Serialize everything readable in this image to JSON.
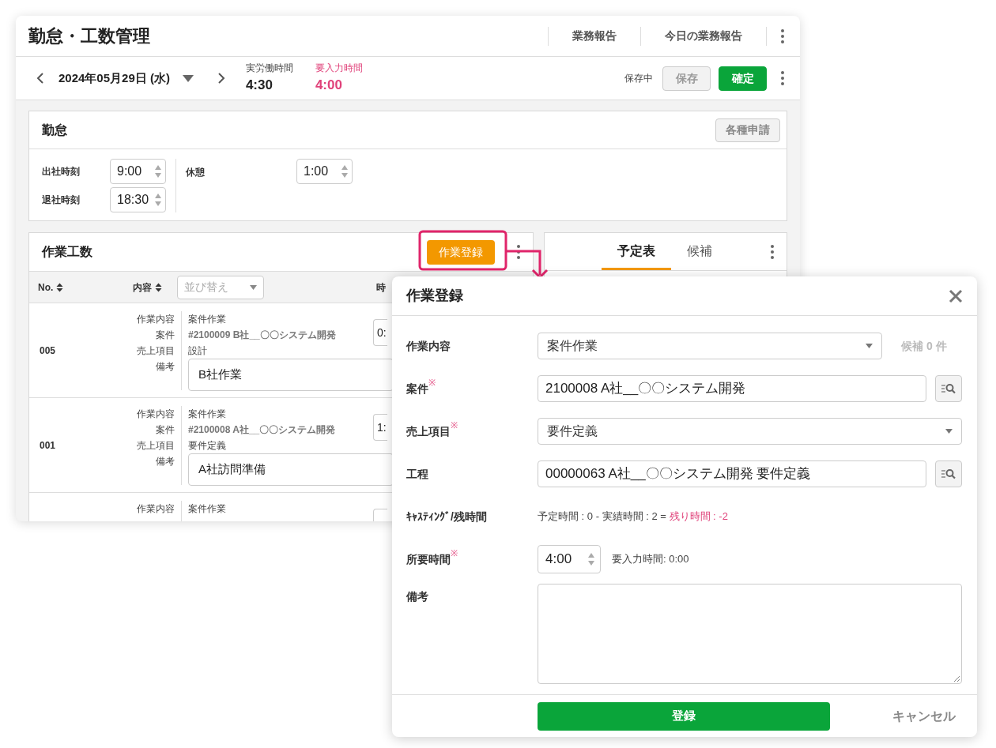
{
  "app": {
    "title": "勤怠・工数管理",
    "header_links": [
      "業務報告",
      "今日の業務報告"
    ]
  },
  "date_bar": {
    "date": "2024年05月29日 (水)",
    "summary": [
      {
        "label": "実労働時間",
        "value": "4:30",
        "alert": false
      },
      {
        "label": "要入力時間",
        "value": "4:00",
        "alert": true
      }
    ],
    "save_status": "保存中",
    "buttons": [
      {
        "label": "保存",
        "kind": "secondary"
      },
      {
        "label": "確定",
        "kind": "primary"
      }
    ]
  },
  "attendance": {
    "title": "勤怠",
    "action": "各種申請",
    "fields": [
      {
        "label": "出社時刻",
        "value": "9:00"
      },
      {
        "label": "退社時刻",
        "value": "18:30"
      }
    ],
    "break": {
      "label": "休憩",
      "value": "1:00"
    }
  },
  "worklog": {
    "title": "作業工数",
    "action": "作業登録",
    "columns": [
      "No.",
      "内容"
    ],
    "sort_placeholder": "並び替え",
    "column_3": "時",
    "rows": [
      {
        "no": "005",
        "fields": [
          {
            "label": "作業内容",
            "value": "案件作業"
          },
          {
            "label": "案件",
            "value": "#2100009 B社__〇〇システム開発"
          },
          {
            "label": "売上項目",
            "value": "設計"
          },
          {
            "label": "備考",
            "value": "B社作業"
          }
        ],
        "time": "0:"
      },
      {
        "no": "001",
        "fields": [
          {
            "label": "作業内容",
            "value": "案件作業"
          },
          {
            "label": "案件",
            "value": "#2100008 A社__〇〇システム開発"
          },
          {
            "label": "売上項目",
            "value": "要件定義"
          },
          {
            "label": "備考",
            "value": "A社訪問準備"
          }
        ],
        "time": "1:"
      },
      {
        "fields": [
          {
            "label": "作業内容",
            "value": "案件作業"
          }
        ]
      }
    ]
  },
  "side_tabs": [
    {
      "label": "予定表",
      "selected": true
    },
    {
      "label": "候補",
      "selected": false
    }
  ],
  "modal": {
    "title": "作業登録",
    "required_mark": "※",
    "fields": [
      {
        "kind": "select",
        "label": "作業内容",
        "required": false,
        "value": "案件作業",
        "note": "候補 0 件"
      },
      {
        "kind": "lookup",
        "label": "案件",
        "required": true,
        "value": "2100008 A社__〇〇システム開発"
      },
      {
        "kind": "select",
        "label": "売上項目",
        "required": true,
        "value": "要件定義"
      },
      {
        "kind": "lookup",
        "label": "工程",
        "required": false,
        "value": "00000063 A社__〇〇システム開発 要件定義"
      },
      {
        "kind": "info",
        "label": "ｷｬｽﾃｨﾝｸﾞ/残時間",
        "required": false,
        "text": "予定時間 : 0 - 実績時間 : 2 = ",
        "alert_text": "残り時間 : -2"
      },
      {
        "kind": "spinner",
        "label": "所要時間",
        "required": true,
        "value": "4:00",
        "note": "要入力時間: 0:00"
      },
      {
        "kind": "textarea",
        "label": "備考",
        "required": false
      }
    ],
    "submit": "登録",
    "cancel": "キャンセル"
  }
}
